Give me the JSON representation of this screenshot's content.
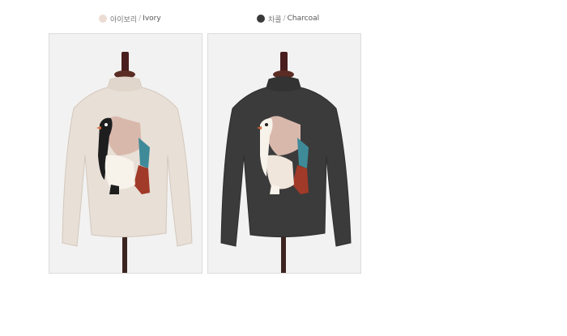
{
  "colors": {
    "ivory_swatch": "#ecdcd3",
    "charcoal_swatch": "#3a3a3a",
    "ivory_knit": "#e8dfd6",
    "charcoal_knit": "#3b3b3b",
    "backdrop": "#f2f2f2",
    "stand": "#3c2420",
    "penguin_black": "#1e1e1e",
    "penguin_pink": "#d9b8ac",
    "penguin_blue": "#3f8a98",
    "penguin_red": "#a13a28",
    "penguin_white": "#f7f2ea"
  },
  "options": [
    {
      "korean": "아이보리",
      "separator": "/",
      "english": "Ivory",
      "swatch_icon": "ivory-circle-icon"
    },
    {
      "korean": "차콜",
      "separator": "/",
      "english": "Charcoal",
      "swatch_icon": "charcoal-circle-icon"
    }
  ],
  "photos": [
    {
      "variant": "ivory",
      "subject": "penguin-knit-sweater"
    },
    {
      "variant": "charcoal",
      "subject": "penguin-knit-sweater"
    }
  ]
}
